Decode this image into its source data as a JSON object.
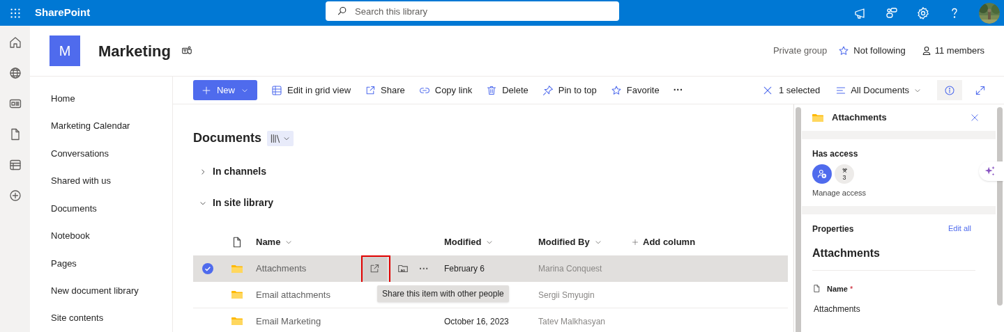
{
  "top_bar": {
    "app_name": "SharePoint",
    "search_placeholder": "Search this library"
  },
  "site": {
    "initial": "M",
    "title": "Marketing",
    "privacy": "Private group",
    "follow": "Not following",
    "members": "11 members"
  },
  "nav": {
    "items": [
      {
        "label": "Home"
      },
      {
        "label": "Marketing Calendar"
      },
      {
        "label": "Conversations"
      },
      {
        "label": "Shared with us"
      },
      {
        "label": "Documents"
      },
      {
        "label": "Notebook"
      },
      {
        "label": "Pages"
      },
      {
        "label": "New document library"
      },
      {
        "label": "Site contents"
      }
    ]
  },
  "command_bar": {
    "actions": [
      {
        "kind": "new",
        "label": "New"
      },
      {
        "kind": "grid",
        "label": "Edit in grid view"
      },
      {
        "kind": "share",
        "label": "Share"
      },
      {
        "kind": "link",
        "label": "Copy link"
      },
      {
        "kind": "delete",
        "label": "Delete"
      },
      {
        "kind": "pin",
        "label": "Pin to top"
      },
      {
        "kind": "favorite",
        "label": "Favorite"
      },
      {
        "kind": "more",
        "label": "···"
      }
    ],
    "selection": "1 selected",
    "view": "All Documents"
  },
  "library": {
    "title": "Documents",
    "sections": [
      {
        "label": "In channels",
        "expanded": false
      },
      {
        "label": "In site library",
        "expanded": true
      }
    ],
    "columns": [
      "Name",
      "Modified",
      "Modified By",
      "Add column"
    ],
    "rows": [
      {
        "name": "Attachments",
        "modified": "February 6",
        "modified_by": "Marina Conquest",
        "selected": true
      },
      {
        "name": "Email attachments",
        "modified": "",
        "modified_by": "Sergii Smyugin",
        "selected": false
      },
      {
        "name": "Email Marketing",
        "modified": "October 16, 2023",
        "modified_by": "Tatev Malkhasyan",
        "selected": false
      }
    ],
    "row_actions": {
      "more": "···"
    },
    "tooltip": "Share this item with other people"
  },
  "details": {
    "title": "Attachments",
    "has_access": "Has access",
    "access_count": "3",
    "manage_access": "Manage access",
    "properties": "Properties",
    "edit_all": "Edit all",
    "item_title": "Attachments",
    "field_label": "Name",
    "required": "*",
    "field_value": "Attachments"
  }
}
